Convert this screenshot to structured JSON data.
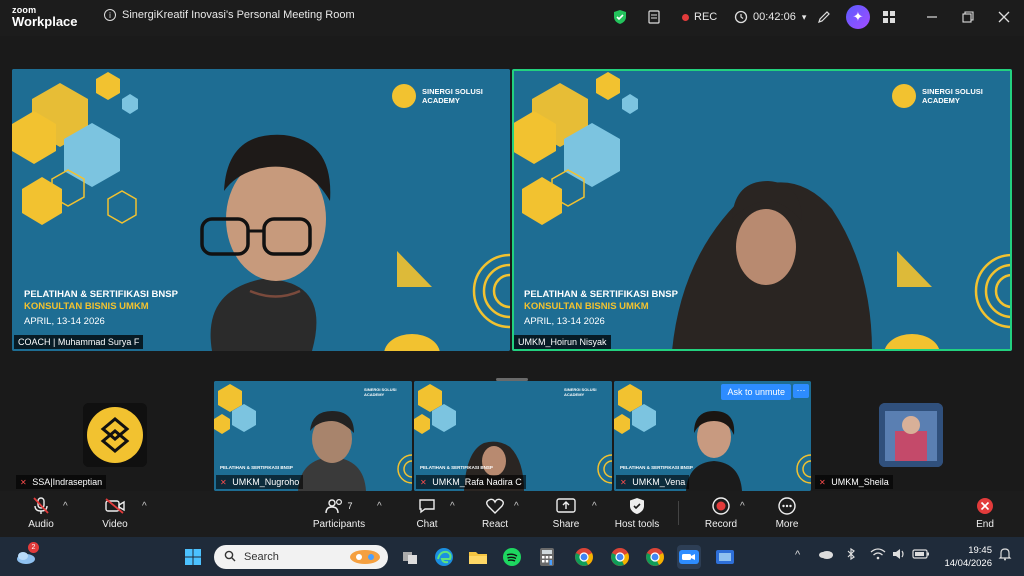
{
  "app": {
    "brand_top": "zoom",
    "brand_bottom": "Workplace"
  },
  "header": {
    "meeting_title": "SinergiKreatif Inovasi's Personal Meeting Room",
    "rec_label": "REC",
    "timer": "00:42:06"
  },
  "slide": {
    "org_line1": "SINERGI SOLUSI",
    "org_line2": "ACADEMY",
    "heading1": "PELATIHAN & SERTIFIKASI BNSP",
    "heading2": "KONSULTAN BISNIS UMKM",
    "date": "APRIL, 13-14  2026"
  },
  "participants": {
    "speaker_left": "COACH | Muhammad Surya F",
    "speaker_right": "UMKM_Hoirun Nisyak",
    "gallery": [
      {
        "name": "SSA|Indraseptian"
      },
      {
        "name": "UMKM_Nugroho"
      },
      {
        "name": "UMKM_Rafa Nadira C"
      },
      {
        "name": "UMKM_Vena"
      },
      {
        "name": "UMKM_Sheila"
      }
    ],
    "ask_unmute": "Ask to unmute",
    "more": "···"
  },
  "toolbar": {
    "audio": "Audio",
    "video": "Video",
    "participants": "Participants",
    "participants_count": "7",
    "chat": "Chat",
    "react": "React",
    "share": "Share",
    "host_tools": "Host tools",
    "record": "Record",
    "more": "More",
    "end": "End"
  },
  "taskbar": {
    "search_placeholder": "Search",
    "weather_badge": "2",
    "time": "19:45",
    "date": "14/04/2026"
  },
  "colors": {
    "slide_bg": "#1e6d93",
    "slide_yellow": "#f2c230",
    "active_speaker": "#23d17f",
    "zoom_blue": "#2d8cff",
    "rec_red": "#e23b3b"
  }
}
